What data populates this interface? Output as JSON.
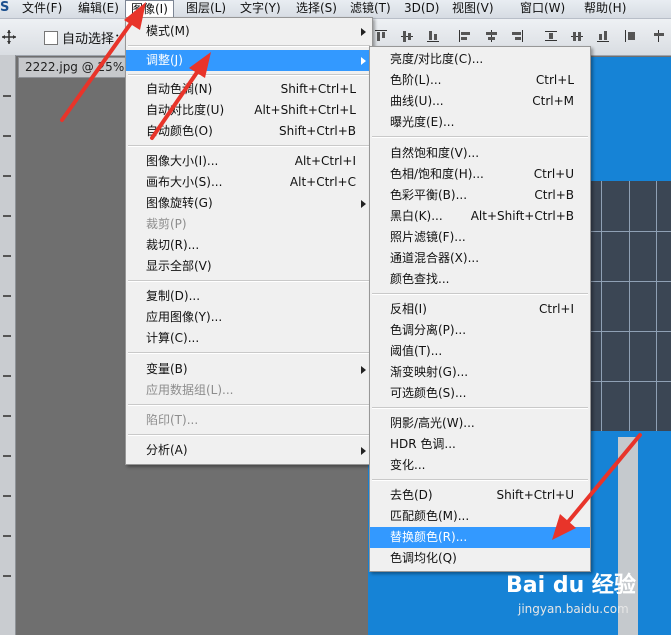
{
  "menubar": {
    "logo": "S",
    "items": [
      "文件(F)",
      "编辑(E)",
      "图像(I)",
      "图层(L)",
      "文字(Y)",
      "选择(S)",
      "滤镜(T)",
      "3D(D)",
      "视图(V)",
      "窗口(W)",
      "帮助(H)"
    ],
    "active": "图像(I)"
  },
  "options_bar": {
    "auto_select_label": "自动选择："
  },
  "document_tab": {
    "title": "2222.jpg @ 25% ("
  },
  "image_menu": {
    "items": [
      {
        "label": "模式(M)",
        "submenu": true
      },
      {
        "label": "调整(J)",
        "submenu": true,
        "highlighted": true
      },
      {
        "label": "自动色调(N)",
        "shortcut": "Shift+Ctrl+L"
      },
      {
        "label": "自动对比度(U)",
        "shortcut": "Alt+Shift+Ctrl+L"
      },
      {
        "label": "自动颜色(O)",
        "shortcut": "Shift+Ctrl+B"
      },
      {
        "label": "图像大小(I)...",
        "shortcut": "Alt+Ctrl+I"
      },
      {
        "label": "画布大小(S)...",
        "shortcut": "Alt+Ctrl+C"
      },
      {
        "label": "图像旋转(G)",
        "submenu": true
      },
      {
        "label": "裁剪(P)",
        "disabled": true
      },
      {
        "label": "裁切(R)..."
      },
      {
        "label": "显示全部(V)"
      },
      {
        "label": "复制(D)..."
      },
      {
        "label": "应用图像(Y)..."
      },
      {
        "label": "计算(C)..."
      },
      {
        "label": "变量(B)",
        "submenu": true
      },
      {
        "label": "应用数据组(L)...",
        "disabled": true
      },
      {
        "label": "陷印(T)...",
        "disabled": true
      },
      {
        "label": "分析(A)",
        "submenu": true
      }
    ]
  },
  "adjust_submenu": {
    "items": [
      {
        "label": "亮度/对比度(C)..."
      },
      {
        "label": "色阶(L)...",
        "shortcut": "Ctrl+L"
      },
      {
        "label": "曲线(U)...",
        "shortcut": "Ctrl+M"
      },
      {
        "label": "曝光度(E)..."
      },
      {
        "label": "自然饱和度(V)..."
      },
      {
        "label": "色相/饱和度(H)...",
        "shortcut": "Ctrl+U"
      },
      {
        "label": "色彩平衡(B)...",
        "shortcut": "Ctrl+B"
      },
      {
        "label": "黑白(K)...",
        "shortcut": "Alt+Shift+Ctrl+B"
      },
      {
        "label": "照片滤镜(F)..."
      },
      {
        "label": "通道混合器(X)..."
      },
      {
        "label": "颜色查找..."
      },
      {
        "label": "反相(I)",
        "shortcut": "Ctrl+I"
      },
      {
        "label": "色调分离(P)..."
      },
      {
        "label": "阈值(T)..."
      },
      {
        "label": "渐变映射(G)..."
      },
      {
        "label": "可选颜色(S)..."
      },
      {
        "label": "阴影/高光(W)..."
      },
      {
        "label": "HDR 色调..."
      },
      {
        "label": "变化..."
      },
      {
        "label": "去色(D)",
        "shortcut": "Shift+Ctrl+U"
      },
      {
        "label": "匹配颜色(M)..."
      },
      {
        "label": "替换颜色(R)...",
        "highlighted": true
      },
      {
        "label": "色调均化(Q)"
      }
    ]
  },
  "watermark": {
    "brand": "Bai du 经验",
    "url": "jingyan.baidu.com"
  },
  "colors": {
    "highlight": "#3399ff",
    "annotation_arrow": "#e8342a",
    "canvas_blue": "#1683d6"
  }
}
